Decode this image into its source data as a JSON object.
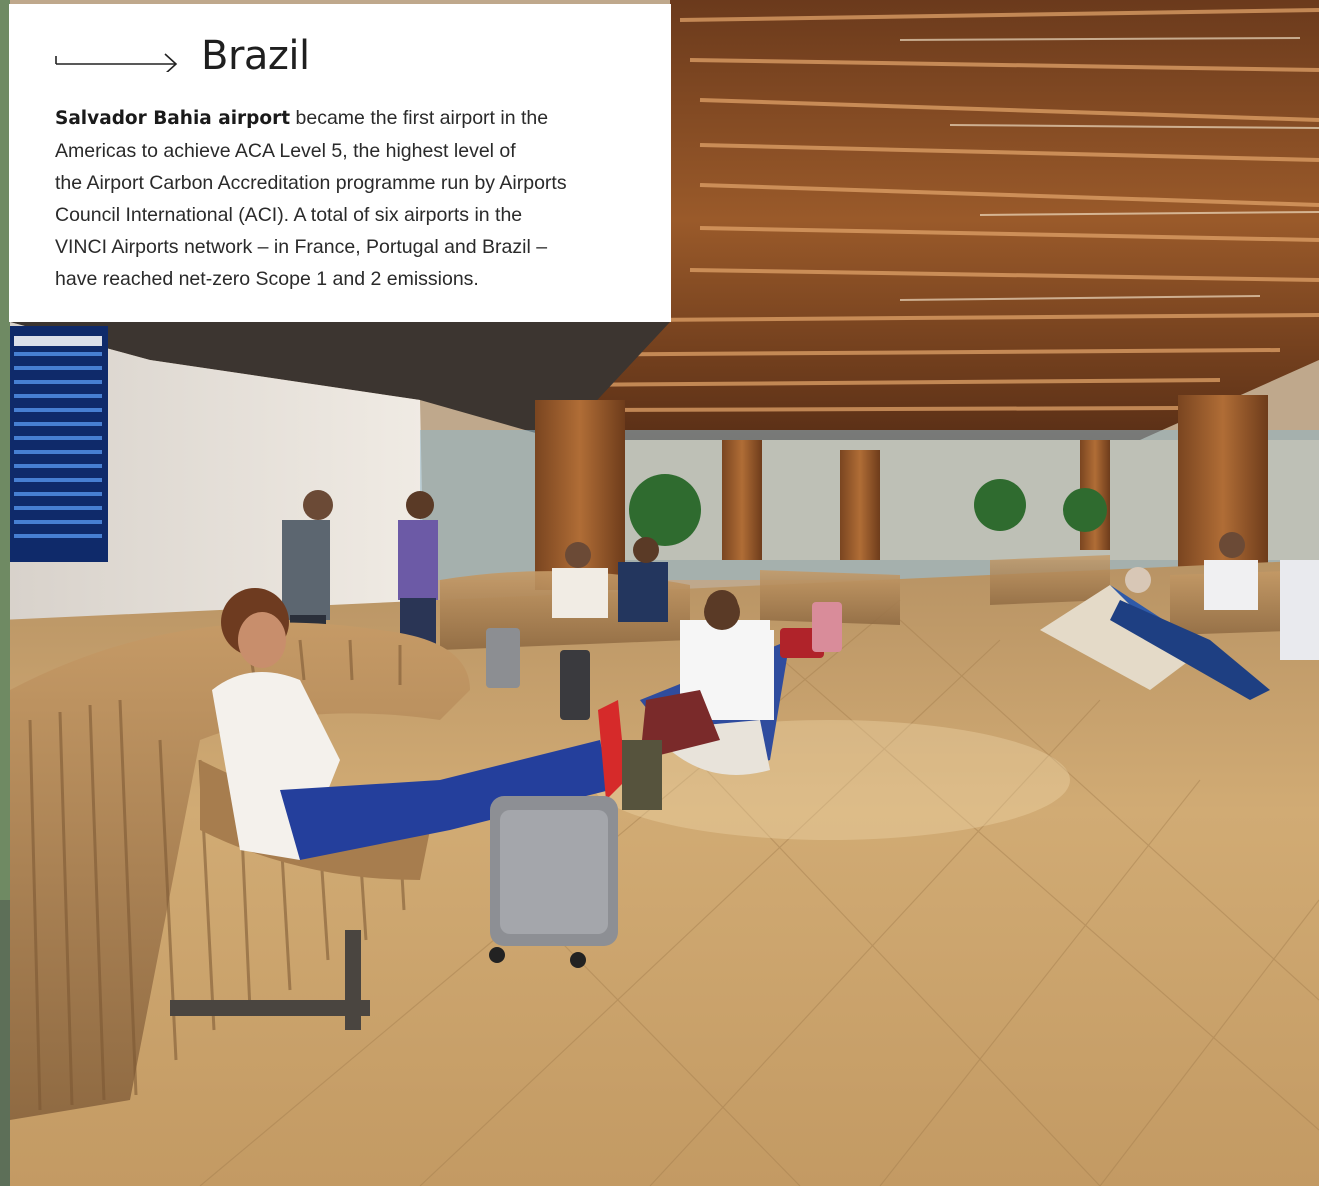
{
  "article": {
    "title": "Brazil",
    "lead": "Salvador Bahia airport",
    "lines": [
      " became the first airport in the",
      "Americas to achieve ACA Level 5, the highest level of",
      "the Airport Carbon Accreditation programme run by Airports",
      "Council International (ACI). A total of six airports in the",
      "VINCI Airports network – in France, Portugal and Brazil –",
      "have reached net-zero Scope 1 and 2 emissions."
    ]
  },
  "photo": {
    "subject": "airport-lounge",
    "colors": {
      "ceiling_wood": "#8a4a22",
      "floor_wood": "#c9a26a",
      "wall": "#e9e4de",
      "bench": "#b58a58"
    }
  },
  "icons": {
    "arrow": "long-right-arrow-icon"
  }
}
